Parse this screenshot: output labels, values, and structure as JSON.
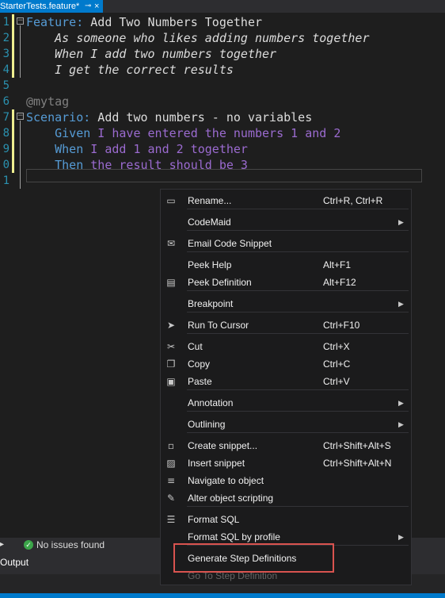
{
  "tab": {
    "title": "StarterTests.feature*",
    "pin_glyph": "⊸",
    "close_glyph": "×"
  },
  "editor": {
    "lines": [
      {
        "num": "1",
        "parts": [
          {
            "cls": "kw-feature",
            "text": "Feature:"
          },
          {
            "cls": "txt",
            "text": " Add Two Numbers Together"
          }
        ]
      },
      {
        "num": "2",
        "parts": [
          {
            "cls": "desc",
            "text": "    As someone who likes adding numbers together"
          }
        ]
      },
      {
        "num": "3",
        "parts": [
          {
            "cls": "desc",
            "text": "    When I add two numbers together"
          }
        ]
      },
      {
        "num": "4",
        "parts": [
          {
            "cls": "desc",
            "text": "    I get the correct results"
          }
        ]
      },
      {
        "num": "5",
        "parts": []
      },
      {
        "num": "6",
        "parts": [
          {
            "cls": "tag",
            "text": "@mytag"
          }
        ]
      },
      {
        "num": "7",
        "parts": [
          {
            "cls": "kw-feature",
            "text": "Scenario:"
          },
          {
            "cls": "txt",
            "text": " Add two numbers - no variables"
          }
        ]
      },
      {
        "num": "8",
        "parts": [
          {
            "cls": "step-kw",
            "text": "    Given"
          },
          {
            "cls": "step-txt",
            "text": " I have entered the numbers 1 and 2"
          }
        ]
      },
      {
        "num": "9",
        "parts": [
          {
            "cls": "step-kw",
            "text": "    When"
          },
          {
            "cls": "step-txt",
            "text": " I add 1 and 2 together"
          }
        ]
      },
      {
        "num": "0",
        "parts": [
          {
            "cls": "step-kw",
            "text": "    Then"
          },
          {
            "cls": "step-txt",
            "text": " the result should be 3"
          }
        ]
      },
      {
        "num": "1",
        "parts": []
      }
    ],
    "collapse_glyph": "−"
  },
  "status": {
    "issues_text": "No issues found",
    "ok_glyph": "✓",
    "arrow_glyph": "▸"
  },
  "output": {
    "title": "Output"
  },
  "context_menu": {
    "items": [
      {
        "label": "Rename...",
        "shortcut": "Ctrl+R, Ctrl+R",
        "icon": "rename-icon",
        "glyph": "▭",
        "submenu": false
      },
      {
        "label": "CodeMaid",
        "shortcut": "",
        "icon": "",
        "glyph": "",
        "submenu": true
      },
      {
        "label": "Email Code Snippet",
        "shortcut": "",
        "icon": "email-icon",
        "glyph": "✉",
        "submenu": false
      },
      {
        "label": "Peek Help",
        "shortcut": "Alt+F1",
        "icon": "",
        "glyph": "",
        "submenu": false
      },
      {
        "label": "Peek Definition",
        "shortcut": "Alt+F12",
        "icon": "peek-definition-icon",
        "glyph": "▤",
        "submenu": false
      },
      {
        "label": "Breakpoint",
        "shortcut": "",
        "icon": "",
        "glyph": "",
        "submenu": true
      },
      {
        "label": "Run To Cursor",
        "shortcut": "Ctrl+F10",
        "icon": "cursor-arrow-icon",
        "glyph": "➤",
        "submenu": false
      },
      {
        "label": "Cut",
        "shortcut": "Ctrl+X",
        "icon": "scissors-icon",
        "glyph": "✂",
        "submenu": false
      },
      {
        "label": "Copy",
        "shortcut": "Ctrl+C",
        "icon": "copy-icon",
        "glyph": "❐",
        "submenu": false
      },
      {
        "label": "Paste",
        "shortcut": "Ctrl+V",
        "icon": "paste-icon",
        "glyph": "▣",
        "submenu": false
      },
      {
        "label": "Annotation",
        "shortcut": "",
        "icon": "",
        "glyph": "",
        "submenu": true
      },
      {
        "label": "Outlining",
        "shortcut": "",
        "icon": "",
        "glyph": "",
        "submenu": true
      },
      {
        "label": "Create snippet...",
        "shortcut": "Ctrl+Shift+Alt+S",
        "icon": "create-snippet-icon",
        "glyph": "▫",
        "submenu": false
      },
      {
        "label": "Insert snippet",
        "shortcut": "Ctrl+Shift+Alt+N",
        "icon": "insert-snippet-icon",
        "glyph": "▨",
        "submenu": false
      },
      {
        "label": "Navigate to object",
        "shortcut": "",
        "icon": "navigate-icon",
        "glyph": "≡",
        "submenu": false
      },
      {
        "label": "Alter object scripting",
        "shortcut": "",
        "icon": "alter-script-icon",
        "glyph": "✎",
        "submenu": false
      },
      {
        "label": "Format SQL",
        "shortcut": "",
        "icon": "format-sql-icon",
        "glyph": "☰",
        "submenu": false
      },
      {
        "label": "Format SQL by profile",
        "shortcut": "",
        "icon": "",
        "glyph": "",
        "submenu": true
      },
      {
        "label": "Generate Step Definitions",
        "shortcut": "",
        "icon": "",
        "glyph": "",
        "submenu": false
      },
      {
        "label": "Go To Step Definition",
        "shortcut": "",
        "icon": "",
        "glyph": "",
        "submenu": false,
        "disabled": true
      }
    ],
    "submenu_glyph": "▶"
  },
  "colors": {
    "accent": "#007acc",
    "highlight_box": "#d9534f",
    "menu_bg": "#1b1b1c"
  }
}
